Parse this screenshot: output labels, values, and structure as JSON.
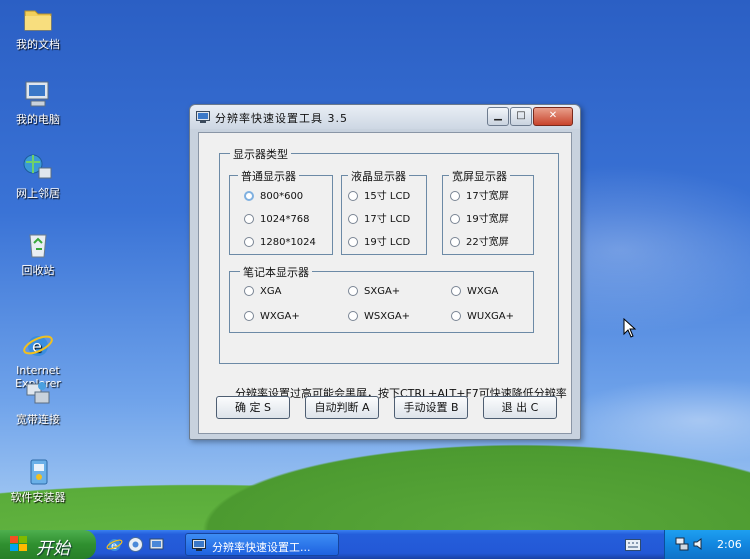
{
  "desktop": {
    "icons": [
      {
        "label": "我的文档",
        "icon": "folder-icon"
      },
      {
        "label": "我的电脑",
        "icon": "computer-icon"
      },
      {
        "label": "网上邻居",
        "icon": "network-icon"
      },
      {
        "label": "回收站",
        "icon": "recycle-bin-icon"
      },
      {
        "label": "Internet\nExplorer",
        "icon": "ie-icon"
      },
      {
        "label": "宽带连接",
        "icon": "broadband-icon"
      },
      {
        "label": "软件安装器",
        "icon": "installer-icon"
      }
    ]
  },
  "dialog": {
    "title": "分辨率快速设置工具 3.5",
    "outer_group": "显示器类型",
    "groups": {
      "normal": {
        "title": "普通显示器",
        "options": [
          "800*600",
          "1024*768",
          "1280*1024"
        ],
        "selected": "800*600"
      },
      "lcd": {
        "title": "液晶显示器",
        "options": [
          "15寸 LCD",
          "17寸 LCD",
          "19寸 LCD"
        ]
      },
      "wide": {
        "title": "宽屏显示器",
        "options": [
          "17寸宽屏",
          "19寸宽屏",
          "22寸宽屏"
        ]
      },
      "notebook": {
        "title": "笔记本显示器",
        "options": [
          "XGA",
          "SXGA+",
          "WXGA",
          "WXGA+",
          "WSXGA+",
          "WUXGA+"
        ]
      }
    },
    "note": "分辨率设置过高可能会黑屏，按下CTRL+ALT+F7可快速降低分辨率",
    "buttons": {
      "ok": "确 定 S",
      "auto": "自动判断 A",
      "manual": "手动设置 B",
      "exit": "退 出 C"
    }
  },
  "taskbar": {
    "start_label": "开始",
    "task_label": "分辨率快速设置工...",
    "clock": "2:06"
  },
  "colors": {
    "taskbar_blue": "#245edb",
    "start_green": "#2f8f2f",
    "tray_blue": "#1287e0",
    "group_border": "#6c8aa6"
  }
}
